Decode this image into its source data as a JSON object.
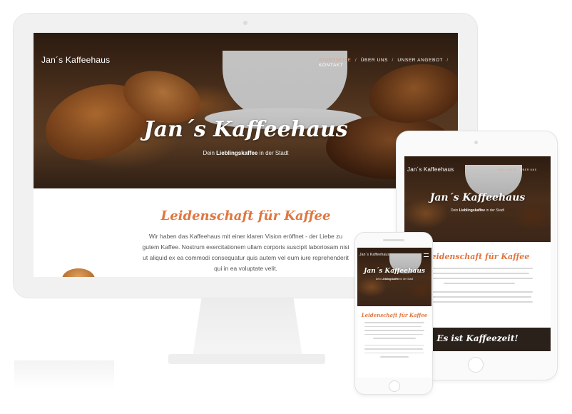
{
  "site": {
    "brand": "Jan´s Kaffeehaus",
    "nav": [
      "STARTSEITE",
      "ÜBER UNS",
      "UNSER ANGEBOT",
      "KONTAKT"
    ],
    "hero_title": "Jan´s Kaffeehaus",
    "hero_sub_before": "Dein ",
    "hero_sub_bold": "Lieblingskaffee",
    "hero_sub_after": " in der Stadt",
    "section_title": "Leidenschaft für Kaffee",
    "section_text": "Wir haben das Kaffeehaus mit einer klaren Vision eröffnet - der Liebe zu gutem Kaffee. Nostrum exercitationem ullam corporis suscipit laboriosam nisi ut aliquid ex ea commodi consequatur quis autem vel eum iure reprehenderit qui in ea voluptate velit.",
    "banner_text": "Es ist Kaffeezeit!"
  },
  "colors": {
    "accent": "#e0763f",
    "nav_active": "#e8a27a",
    "device_frame": "#f1f1f1"
  }
}
